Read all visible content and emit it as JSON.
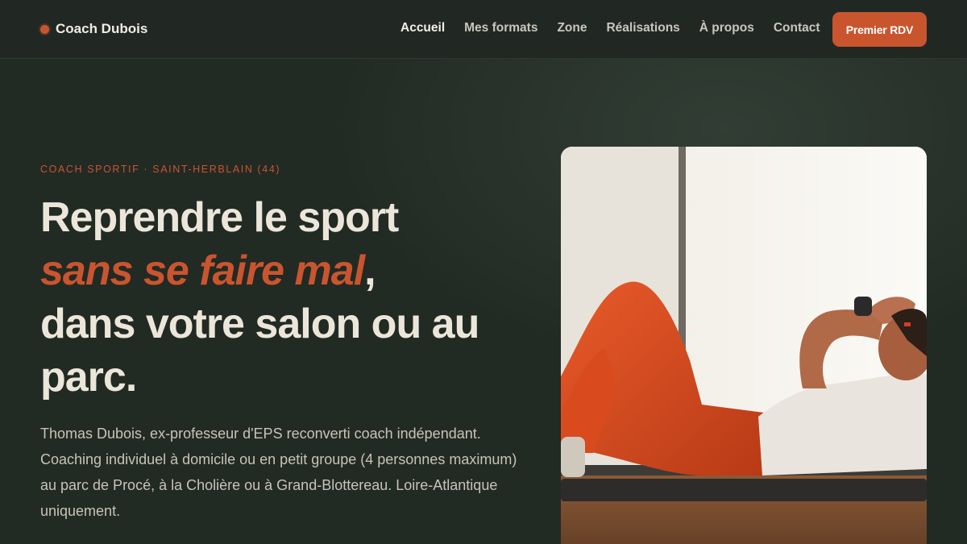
{
  "header": {
    "brand": "Coach Dubois",
    "nav": [
      {
        "label": "Accueil",
        "active": true
      },
      {
        "label": "Mes formats",
        "active": false
      },
      {
        "label": "Zone",
        "active": false
      },
      {
        "label": "Réalisations",
        "active": false
      },
      {
        "label": "À propos",
        "active": false
      },
      {
        "label": "Contact",
        "active": false
      }
    ],
    "cta": "Premier RDV"
  },
  "hero": {
    "eyebrow": "COACH SPORTIF · SAINT-HERBLAIN (44)",
    "title_part1": "Reprendre le sport",
    "title_highlight": "sans se faire mal",
    "title_comma": ",",
    "title_part2": "dans votre salon ou au parc.",
    "intro": "Thomas Dubois, ex-professeur d'EPS reconverti coach indépendant. Coaching individuel à domicile ou en petit groupe (4 personnes maximum) au parc de Procé, à la Cholière ou à Grand-Blottereau. Loire-Atlantique uniquement."
  },
  "colors": {
    "background": "#222a24",
    "accent": "#c9552f",
    "text": "#ece6da"
  }
}
